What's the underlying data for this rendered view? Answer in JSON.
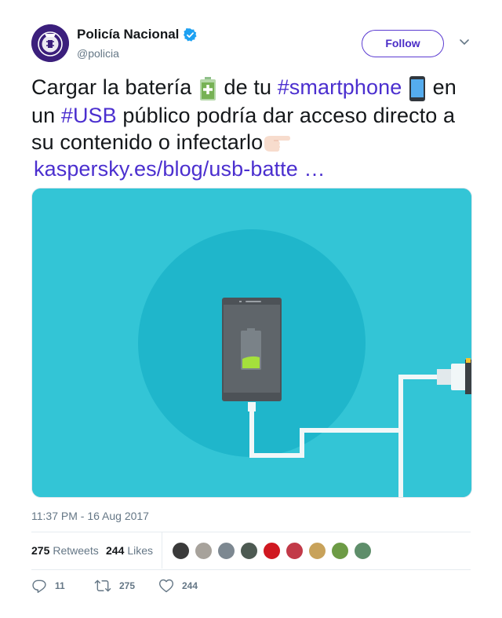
{
  "author": {
    "name": "Policía Nacional",
    "handle": "@policia",
    "avatar_color": "#3b1f7c",
    "verified_color": "#1da1f2",
    "avatar_icon": "police-badge-icon"
  },
  "follow_button": {
    "label": "Follow",
    "color": "#4a2cc7"
  },
  "tweet": {
    "text_1": "Cargar la batería ",
    "emoji_1": "battery-charging-emoji",
    "text_2": " de tu ",
    "hashtag_1": "#smartphone",
    "emoji_2": "smartphone-emoji",
    "text_3": " en un ",
    "hashtag_2": "#USB",
    "text_4": " público podría dar acceso directo a su contenido o infectarlo",
    "emoji_3": "pointing-right-emoji",
    "link": "kaspersky.es/blog/usb-batte …"
  },
  "media": {
    "description_icon": "phone-charging-usb-illustration",
    "bg_color": "#33c5d6"
  },
  "timestamp": "11:37 PM - 16 Aug 2017",
  "stats": {
    "retweets_count": "275",
    "retweets_label": "Retweets",
    "likes_count": "244",
    "likes_label": "Likes"
  },
  "likers": [
    {
      "name": "liker-1",
      "color": "#3a3a3a"
    },
    {
      "name": "liker-2",
      "color": "#a7a29b"
    },
    {
      "name": "liker-3",
      "color": "#7d8891"
    },
    {
      "name": "liker-4",
      "color": "#4d5a52"
    },
    {
      "name": "liker-5",
      "color": "#d01820"
    },
    {
      "name": "liker-6",
      "color": "#c23a48"
    },
    {
      "name": "liker-7",
      "color": "#c8a25a"
    },
    {
      "name": "liker-8",
      "color": "#6d9b45"
    },
    {
      "name": "liker-9",
      "color": "#5e8e6a"
    }
  ],
  "actions": {
    "reply_count": "11",
    "retweet_count": "275",
    "like_count": "244"
  }
}
